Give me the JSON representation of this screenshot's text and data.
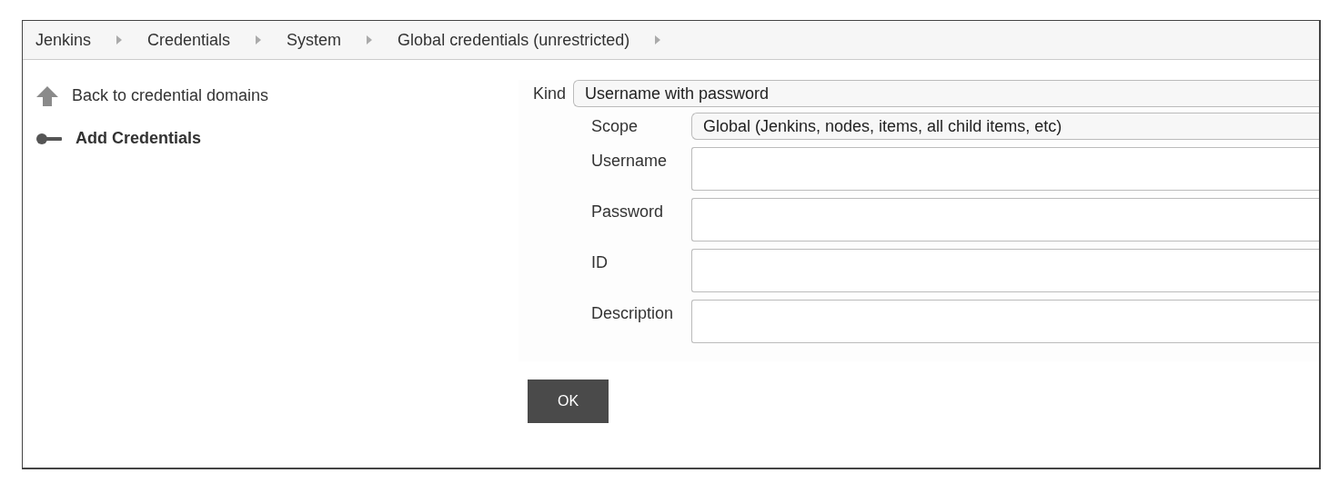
{
  "breadcrumbs": [
    {
      "label": "Jenkins"
    },
    {
      "label": "Credentials"
    },
    {
      "label": "System"
    },
    {
      "label": "Global credentials (unrestricted)"
    }
  ],
  "sidebar": {
    "items": [
      {
        "label": "Back to credential domains",
        "kind": "back",
        "selected": false
      },
      {
        "label": "Add Credentials",
        "kind": "add",
        "selected": true
      }
    ]
  },
  "form": {
    "kind": {
      "label": "Kind",
      "value": "Username with password"
    },
    "fields": [
      {
        "label": "Scope",
        "kind": "select",
        "value": "Global (Jenkins, nodes, items, all child items, etc)"
      },
      {
        "label": "Username",
        "kind": "text"
      },
      {
        "label": "Password",
        "kind": "text"
      },
      {
        "label": "ID",
        "kind": "text"
      },
      {
        "label": "Description",
        "kind": "text"
      }
    ]
  },
  "buttons": [
    {
      "label": "OK"
    }
  ]
}
